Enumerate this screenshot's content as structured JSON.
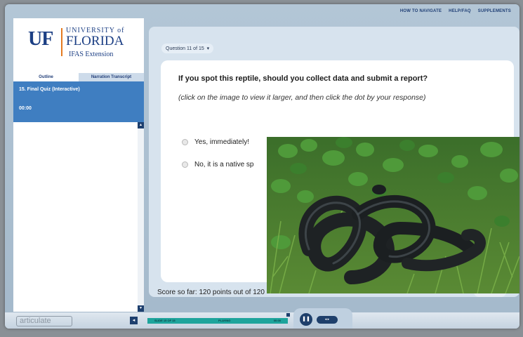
{
  "top_nav": [
    "HOW TO NAVIGATE",
    "HELP/FAQ",
    "SUPPLEMENTS"
  ],
  "logo": {
    "mark": "UF",
    "line1": "UNIVERSITY of",
    "line2": "FLORIDA",
    "line3": "IFAS Extension"
  },
  "sidebar": {
    "tabs": [
      "Outline",
      "Narration Transcript"
    ],
    "items": [
      {
        "label": "15. Final Quiz (Interactive)"
      }
    ],
    "time": "00:00"
  },
  "question": {
    "selector": "Question 11 of 15",
    "text": "If you spot this reptile, should you collect data and submit a report?",
    "instruction": "(click on the image to view it larger, and then click the dot by your response)",
    "options": [
      "Yes, immediately!",
      "No, it is a native sp"
    ]
  },
  "score_text": "Score so far: 120 points out of 120",
  "bottom": {
    "brand": "articulate",
    "progress_labels": [
      "SLIDE 15 OF 15",
      "PLAYING",
      "00:00"
    ]
  },
  "colors": {
    "accent_blue": "#3f7ec1",
    "uf_blue": "#1c3f84",
    "uf_orange": "#e47a20",
    "progress": "#1ea49c"
  }
}
